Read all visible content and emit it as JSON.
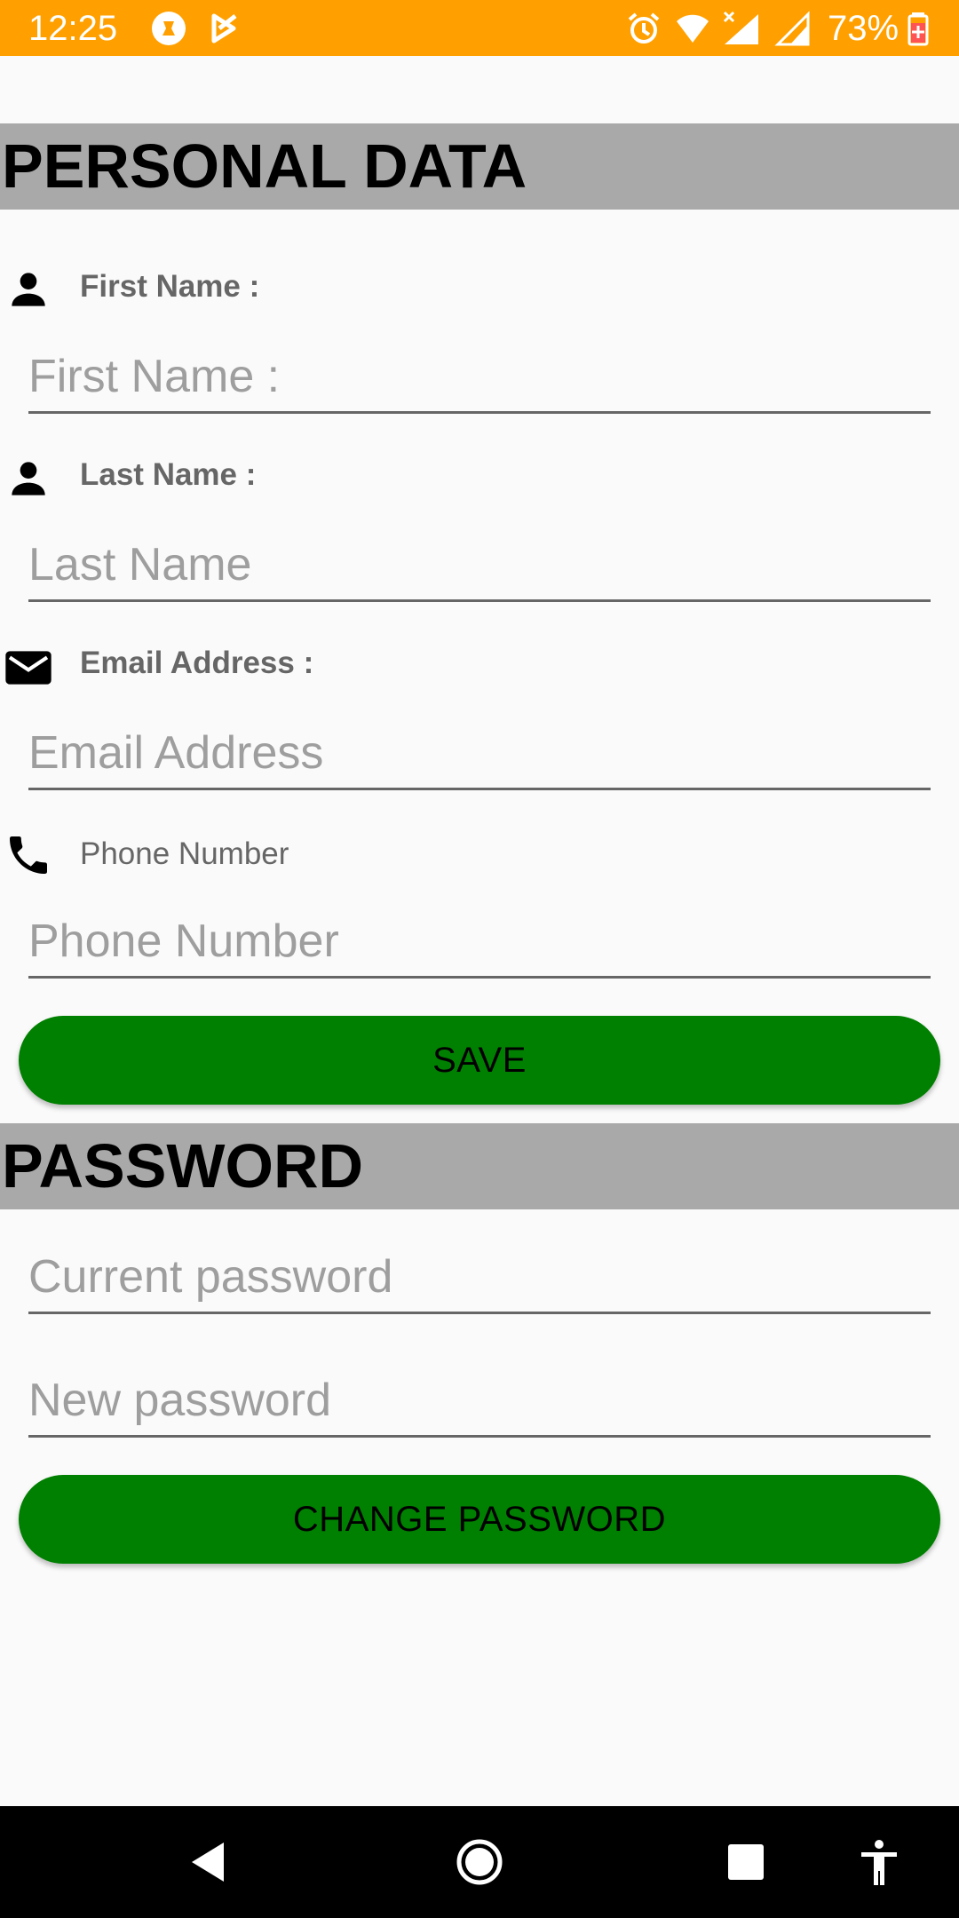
{
  "status_bar": {
    "time": "12:25",
    "battery_percent": "73%",
    "background_color": "#ffa000",
    "icons": [
      "app-notification-icon",
      "play-store-icon",
      "alarm-icon",
      "wifi-icon",
      "signal-icon",
      "signal-icon",
      "battery-icon"
    ]
  },
  "personal_data": {
    "header": "PERSONAL DATA",
    "first_name": {
      "label": "First Name :",
      "placeholder": "First Name :",
      "value": ""
    },
    "last_name": {
      "label": "Last Name :",
      "placeholder": "Last Name",
      "value": ""
    },
    "email": {
      "label": "Email Address :",
      "placeholder": "Email Address",
      "value": ""
    },
    "phone": {
      "label": "Phone Number",
      "placeholder": "Phone Number",
      "value": ""
    },
    "save_label": "SAVE"
  },
  "password": {
    "header": "PASSWORD",
    "current": {
      "placeholder": "Current password",
      "value": ""
    },
    "new": {
      "placeholder": "New password",
      "value": ""
    },
    "change_label": "CHANGE PASSWORD"
  },
  "colors": {
    "accent": "#008000",
    "header_bg": "#a9a9a9",
    "page_bg": "#fafafa"
  },
  "nav_bar": {
    "icons": [
      "back-icon",
      "home-icon",
      "recents-icon",
      "accessibility-icon"
    ]
  }
}
